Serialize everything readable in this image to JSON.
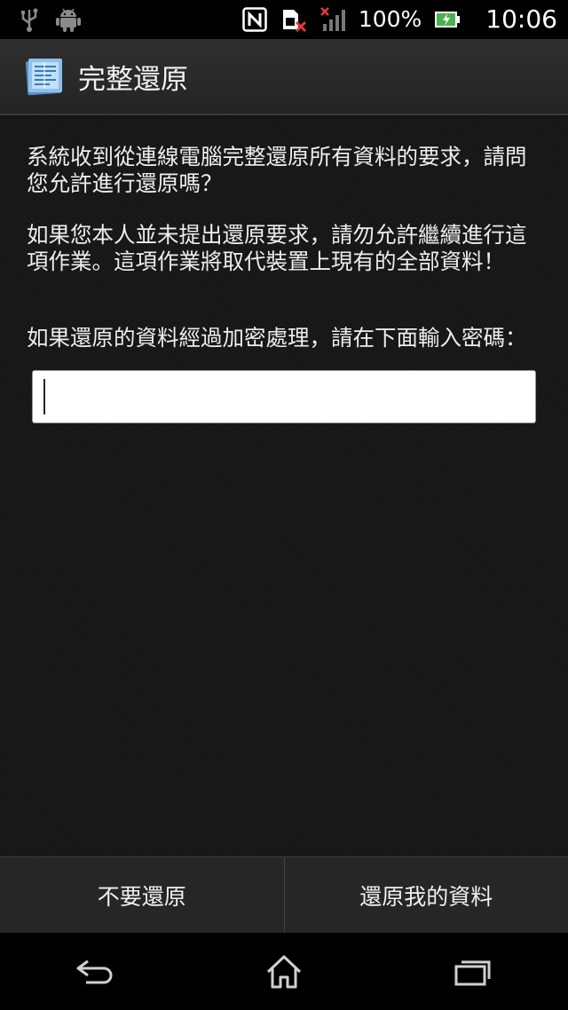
{
  "status_bar": {
    "battery_text": "100%",
    "clock": "10:06",
    "icons": [
      "usb-icon",
      "android-debug-icon",
      "nfc-icon",
      "sim-error-icon",
      "signal-icon",
      "battery-icon"
    ]
  },
  "title_bar": {
    "app_icon": "backup-restore-icon",
    "title": "完整還原"
  },
  "content": {
    "message1": "系統收到從連線電腦完整還原所有資料的要求，請問\n您允許進行還原嗎？",
    "message2": "如果您本人並未提出還原要求，請勿允許繼續進行這\n項作業。這項作業將取代裝置上現有的全部資料！",
    "password_prompt": "如果還原的資料經過加密處理，請在下面輸入密碼：",
    "password_value": "",
    "password_placeholder": ""
  },
  "buttons": {
    "deny": "不要還原",
    "allow": "還原我的資料"
  },
  "navigation": {
    "icons": [
      "back-icon",
      "home-icon",
      "recent-apps-icon"
    ]
  },
  "colors": {
    "background": "#141414",
    "status_bar": "#000000",
    "title_bar": "#2a2a2a",
    "text": "#eeeeee",
    "input_background": "#ffffff"
  }
}
